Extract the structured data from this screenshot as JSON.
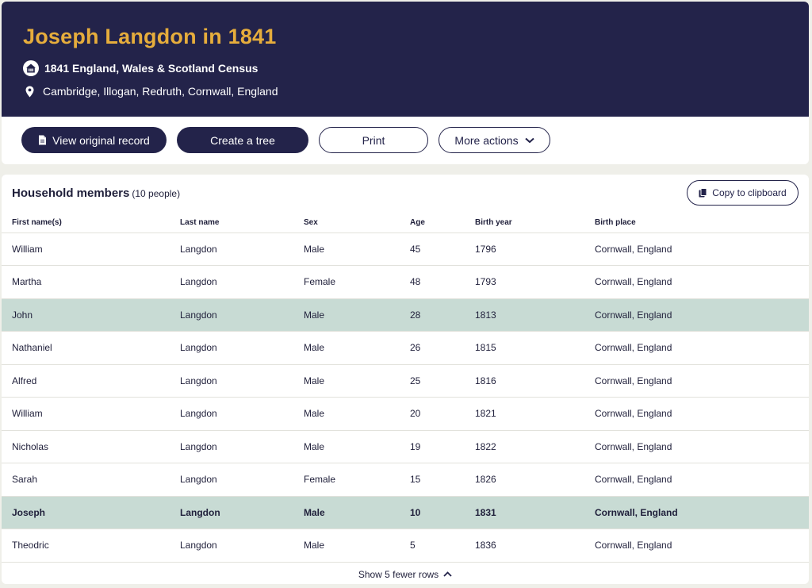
{
  "header": {
    "title": "Joseph Langdon in 1841",
    "collection": "1841 England, Wales & Scotland Census",
    "location": "Cambridge, Illogan, Redruth, Cornwall, England",
    "colors": {
      "background": "#23234a",
      "title": "#e6ad3c"
    }
  },
  "actions": {
    "view_original": "View original record",
    "create_tree": "Create a tree",
    "print": "Print",
    "more_actions": "More actions"
  },
  "household": {
    "title": "Household members",
    "count": "(10 people)",
    "copy_label": "Copy to clipboard",
    "columns": [
      "First name(s)",
      "Last name",
      "Sex",
      "Age",
      "Birth year",
      "Birth place"
    ],
    "rows": [
      [
        "William",
        "Langdon",
        "Male",
        "45",
        "1796",
        "Cornwall, England"
      ],
      [
        "Martha",
        "Langdon",
        "Female",
        "48",
        "1793",
        "Cornwall, England"
      ],
      [
        "John",
        "Langdon",
        "Male",
        "28",
        "1813",
        "Cornwall, England"
      ],
      [
        "Nathaniel",
        "Langdon",
        "Male",
        "26",
        "1815",
        "Cornwall, England"
      ],
      [
        "Alfred",
        "Langdon",
        "Male",
        "25",
        "1816",
        "Cornwall, England"
      ],
      [
        "William",
        "Langdon",
        "Male",
        "20",
        "1821",
        "Cornwall, England"
      ],
      [
        "Nicholas",
        "Langdon",
        "Male",
        "19",
        "1822",
        "Cornwall, England"
      ],
      [
        "Sarah",
        "Langdon",
        "Female",
        "15",
        "1826",
        "Cornwall, England"
      ],
      [
        "Joseph",
        "Langdon",
        "Male",
        "10",
        "1831",
        "Cornwall, England"
      ],
      [
        "Theodric",
        "Langdon",
        "Male",
        "5",
        "1836",
        "Cornwall, England"
      ]
    ],
    "highlight_color": "#c8dbd4",
    "show_fewer": "Show 5 fewer rows"
  }
}
